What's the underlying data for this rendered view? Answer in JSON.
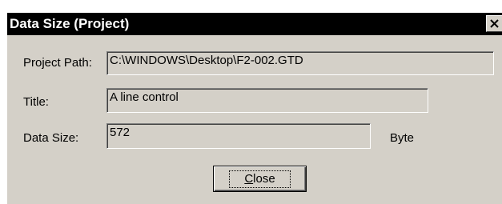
{
  "dialog": {
    "title": "Data Size (Project)",
    "close_icon": "close-x-icon"
  },
  "fields": {
    "project_path": {
      "label": "Project Path:",
      "value": "C:\\WINDOWS\\Desktop\\F2-002.GTD"
    },
    "title": {
      "label": "Title:",
      "value": "A line control"
    },
    "data_size": {
      "label": "Data Size:",
      "value": "572",
      "unit": "Byte"
    }
  },
  "buttons": {
    "close_accel": "C",
    "close_rest": "lose"
  },
  "colors": {
    "titlebar": "#000000",
    "face": "#d4d0c8"
  }
}
